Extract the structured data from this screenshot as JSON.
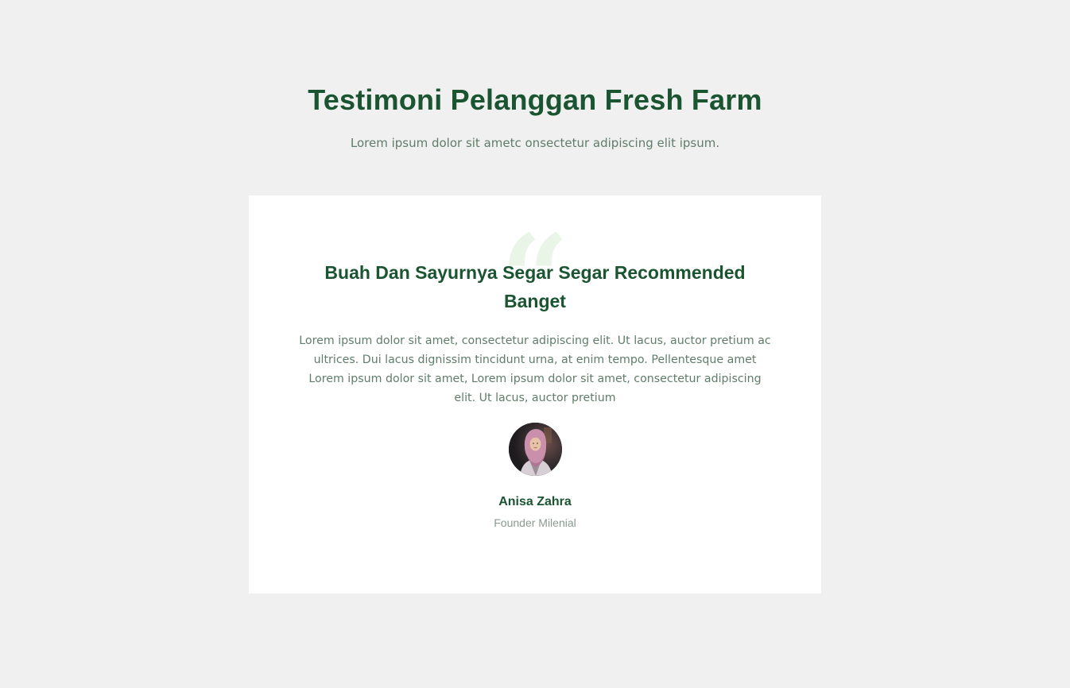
{
  "section": {
    "title": "Testimoni Pelanggan Fresh Farm",
    "subtitle": "Lorem ipsum dolor sit ametc onsectetur adipiscing elit ipsum."
  },
  "testimonial": {
    "quote_icon": "quote-mark-icon",
    "quote_glyph": "“",
    "title": "Buah Dan Sayurnya Segar Segar Recommended Banget",
    "text": "Lorem ipsum dolor sit amet, consectetur adipiscing elit. Ut lacus, auctor pretium ac ultrices. Dui lacus dignissim tincidunt urna, at enim tempo. Pellentesque amet Lorem ipsum dolor sit amet, Lorem ipsum dolor sit amet, consectetur adipiscing elit. Ut lacus, auctor pretium",
    "author": {
      "name": "Anisa Zahra",
      "role": "Founder Milenial"
    }
  },
  "colors": {
    "background": "#f0f0f0",
    "card": "#ffffff",
    "heading": "#1b5431",
    "body_text": "#5f7d68",
    "muted_text": "#8a9a8f",
    "quote_icon": "#e9f6e7"
  }
}
